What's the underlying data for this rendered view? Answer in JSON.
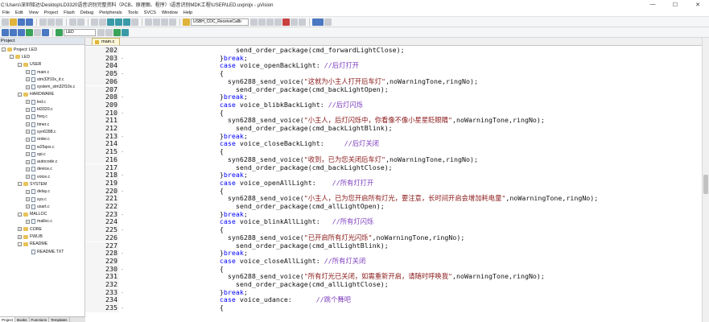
{
  "window": {
    "title": "C:\\Users\\深圳铭达\\Desktop\\LD3320语音识别完整资料（PCB、原理图、程序）\\语音识别MDK工程\\USER\\LED.uvprojx - µVision",
    "controls": [
      "—",
      "☐",
      "✕"
    ]
  },
  "menu": [
    "File",
    "Edit",
    "View",
    "Project",
    "Flash",
    "Debug",
    "Peripherals",
    "Tools",
    "SVCS",
    "Window",
    "Help"
  ],
  "toolbar": {
    "function_combo": "USBH_CDC_ReceiveCallb",
    "target_combo": "LED"
  },
  "project": {
    "header": "Project",
    "tree": [
      {
        "label": "Project: LED",
        "level": 0,
        "kind": "root",
        "exp": "-"
      },
      {
        "label": "LED",
        "level": 1,
        "kind": "folder",
        "exp": "-"
      },
      {
        "label": "USER",
        "level": 2,
        "kind": "folder",
        "exp": "-"
      },
      {
        "label": "main.c",
        "level": 3,
        "kind": "file",
        "exp": "+"
      },
      {
        "label": "stm32f10x_it.c",
        "level": 3,
        "kind": "file",
        "exp": "+"
      },
      {
        "label": "system_stm32f10x.c",
        "level": 3,
        "kind": "file",
        "exp": "+"
      },
      {
        "label": "HARDWARE",
        "level": 2,
        "kind": "folder",
        "exp": "-"
      },
      {
        "label": "led.c",
        "level": 3,
        "kind": "file",
        "exp": "+"
      },
      {
        "label": "ld3320.c",
        "level": 3,
        "kind": "file",
        "exp": "+"
      },
      {
        "label": "freq.c",
        "level": 3,
        "kind": "file",
        "exp": "+"
      },
      {
        "label": "timer.c",
        "level": 3,
        "kind": "file",
        "exp": "+"
      },
      {
        "label": "syn6288.c",
        "level": 3,
        "kind": "file",
        "exp": "+"
      },
      {
        "label": "order.c",
        "level": 3,
        "kind": "file",
        "exp": "+"
      },
      {
        "label": "w25qxx.c",
        "level": 3,
        "kind": "file",
        "exp": "+"
      },
      {
        "label": "spi.c",
        "level": 3,
        "kind": "file",
        "exp": "+"
      },
      {
        "label": "autocode.c",
        "level": 3,
        "kind": "file",
        "exp": "+"
      },
      {
        "label": "device.c",
        "level": 3,
        "kind": "file",
        "exp": "+"
      },
      {
        "label": "voice.c",
        "level": 3,
        "kind": "file",
        "exp": "+"
      },
      {
        "label": "SYSTEM",
        "level": 2,
        "kind": "folder",
        "exp": "-"
      },
      {
        "label": "delay.c",
        "level": 3,
        "kind": "file",
        "exp": "+"
      },
      {
        "label": "sys.c",
        "level": 3,
        "kind": "file",
        "exp": "+"
      },
      {
        "label": "usart.c",
        "level": 3,
        "kind": "file",
        "exp": "+"
      },
      {
        "label": "MALLOC",
        "level": 2,
        "kind": "folder",
        "exp": "-"
      },
      {
        "label": "malloc.c",
        "level": 3,
        "kind": "file",
        "exp": "+"
      },
      {
        "label": "CORE",
        "level": 2,
        "kind": "folder",
        "exp": "+"
      },
      {
        "label": "FWLIB",
        "level": 2,
        "kind": "folder",
        "exp": "+"
      },
      {
        "label": "README",
        "level": 2,
        "kind": "folder",
        "exp": "-"
      },
      {
        "label": "README.TXT",
        "level": 3,
        "kind": "file",
        "exp": ""
      }
    ],
    "bottom_tabs": [
      "Project",
      "Books",
      "Functions",
      "Templates"
    ]
  },
  "editor": {
    "active_tab": "main.c",
    "lines": [
      {
        "n": "202",
        "fold": "",
        "parts": [
          [
            "",
            "                           send_order_package(cmd_forwardLightClose);"
          ]
        ]
      },
      {
        "n": "203",
        "fold": "-",
        "parts": [
          [
            "",
            "                       }"
          ],
          [
            "kw",
            "break"
          ],
          [
            "",
            ";"
          ]
        ]
      },
      {
        "n": "204",
        "fold": "",
        "parts": [
          [
            "",
            "                       "
          ],
          [
            "kw",
            "case"
          ],
          [
            "",
            " voice_openBackLight: "
          ],
          [
            "cm",
            "//后灯打开"
          ]
        ]
      },
      {
        "n": "205",
        "fold": "-",
        "parts": [
          [
            "",
            "                       {"
          ]
        ]
      },
      {
        "n": "206",
        "fold": "",
        "parts": [
          [
            "",
            "                         syn6288_send_voice("
          ],
          [
            "st",
            "\"这就为小主人打开后车灯\""
          ],
          [
            "",
            ",noWarningTone,ringNo);"
          ]
        ]
      },
      {
        "n": "207",
        "fold": "",
        "parts": [
          [
            "",
            "                           send_order_package(cmd_backLightOpen);"
          ]
        ]
      },
      {
        "n": "208",
        "fold": "-",
        "parts": [
          [
            "",
            "                       }"
          ],
          [
            "kw",
            "break"
          ],
          [
            "",
            ";"
          ]
        ]
      },
      {
        "n": "209",
        "fold": "",
        "parts": [
          [
            "",
            "                       "
          ],
          [
            "kw",
            "case"
          ],
          [
            "",
            " voice_blibkBackLight: "
          ],
          [
            "cm",
            "//后灯闪烁"
          ]
        ]
      },
      {
        "n": "210",
        "fold": "-",
        "parts": [
          [
            "",
            "                       {"
          ]
        ]
      },
      {
        "n": "211",
        "fold": "",
        "parts": [
          [
            "",
            "                         syn6288_send_voice("
          ],
          [
            "st",
            "\"小主人，后灯闪烁中，你看像不像小星星眨眼睛\""
          ],
          [
            "",
            ",noWarningTone,ringNo);"
          ]
        ]
      },
      {
        "n": "212",
        "fold": "",
        "parts": [
          [
            "",
            "                           send_order_package(cmd_backLightBlink);"
          ]
        ]
      },
      {
        "n": "213",
        "fold": "-",
        "parts": [
          [
            "",
            "                       }"
          ],
          [
            "kw",
            "break"
          ],
          [
            "",
            ";"
          ]
        ]
      },
      {
        "n": "214",
        "fold": "",
        "parts": [
          [
            "",
            "                       "
          ],
          [
            "kw",
            "case"
          ],
          [
            "",
            " voice_closeBackLight:     "
          ],
          [
            "cm",
            "//后灯关闭"
          ]
        ]
      },
      {
        "n": "215",
        "fold": "-",
        "parts": [
          [
            "",
            "                       {"
          ]
        ]
      },
      {
        "n": "216",
        "fold": "",
        "parts": [
          [
            "",
            "                         syn6288_send_voice("
          ],
          [
            "st",
            "\"收到，已为您关闭后车灯\""
          ],
          [
            "",
            ",noWarningTone,ringNo);"
          ]
        ]
      },
      {
        "n": "217",
        "fold": "",
        "parts": [
          [
            "",
            "                           send_order_package(cmd_backLightClose);"
          ]
        ]
      },
      {
        "n": "218",
        "fold": "-",
        "parts": [
          [
            "",
            "                       }"
          ],
          [
            "kw",
            "break"
          ],
          [
            "",
            ";"
          ]
        ]
      },
      {
        "n": "219",
        "fold": "",
        "parts": [
          [
            "",
            "                       "
          ],
          [
            "kw",
            "case"
          ],
          [
            "",
            " voice_openAllLight:    "
          ],
          [
            "cm",
            "//所有灯打开"
          ]
        ]
      },
      {
        "n": "220",
        "fold": "-",
        "parts": [
          [
            "",
            "                       {"
          ]
        ]
      },
      {
        "n": "221",
        "fold": "",
        "parts": [
          [
            "",
            "                         syn6288_send_voice("
          ],
          [
            "st",
            "\"小主人，已为您开启所有灯光，要注意，长时间开启会增加耗电量\""
          ],
          [
            "",
            ",noWarningTone,ringNo);"
          ]
        ]
      },
      {
        "n": "222",
        "fold": "",
        "parts": [
          [
            "",
            "                           send_order_package(cmd_allLightOpen);"
          ]
        ]
      },
      {
        "n": "223",
        "fold": "-",
        "parts": [
          [
            "",
            "                       }"
          ],
          [
            "kw",
            "break"
          ],
          [
            "",
            ";"
          ]
        ]
      },
      {
        "n": "224",
        "fold": "",
        "parts": [
          [
            "",
            "                       "
          ],
          [
            "kw",
            "case"
          ],
          [
            "",
            " voice_blinkAllLight:   "
          ],
          [
            "cm",
            "//所有灯闪烁"
          ]
        ]
      },
      {
        "n": "225",
        "fold": "-",
        "parts": [
          [
            "",
            "                       {"
          ]
        ]
      },
      {
        "n": "226",
        "fold": "",
        "parts": [
          [
            "",
            "                         syn6288_send_voice("
          ],
          [
            "st",
            "\"已开启所有灯光闪烁\""
          ],
          [
            "",
            ",noWarningTone,ringNo);"
          ]
        ]
      },
      {
        "n": "227",
        "fold": "",
        "parts": [
          [
            "",
            "                           send_order_package(cmd_allLightBlink);"
          ]
        ]
      },
      {
        "n": "228",
        "fold": "-",
        "parts": [
          [
            "",
            "                       }"
          ],
          [
            "kw",
            "break"
          ],
          [
            "",
            ";"
          ]
        ]
      },
      {
        "n": "229",
        "fold": "",
        "parts": [
          [
            "",
            "                       "
          ],
          [
            "kw",
            "case"
          ],
          [
            "",
            " voice_closeAllLight: "
          ],
          [
            "cm",
            "//所有灯关闭"
          ]
        ]
      },
      {
        "n": "230",
        "fold": "-",
        "parts": [
          [
            "",
            "                       {"
          ]
        ]
      },
      {
        "n": "231",
        "fold": "",
        "parts": [
          [
            "",
            "                         syn6288_send_voice("
          ],
          [
            "st",
            "\"所有灯光已关闭，如需重新开启，请随时呼唤我\""
          ],
          [
            "",
            ",noWarningTone,ringNo);"
          ]
        ]
      },
      {
        "n": "232",
        "fold": "",
        "parts": [
          [
            "",
            "                           send_order_package(cmd_allLightClose);"
          ]
        ]
      },
      {
        "n": "233",
        "fold": "-",
        "parts": [
          [
            "",
            "                       }"
          ],
          [
            "kw",
            "break"
          ],
          [
            "",
            ";"
          ]
        ]
      },
      {
        "n": "234",
        "fold": "",
        "parts": [
          [
            "",
            "                       "
          ],
          [
            "kw",
            "case"
          ],
          [
            "",
            " voice_udance:      "
          ],
          [
            "cm",
            "//跳个舞吧"
          ]
        ]
      },
      {
        "n": "235",
        "fold": "-",
        "parts": [
          [
            "",
            "                       {"
          ]
        ]
      }
    ]
  }
}
